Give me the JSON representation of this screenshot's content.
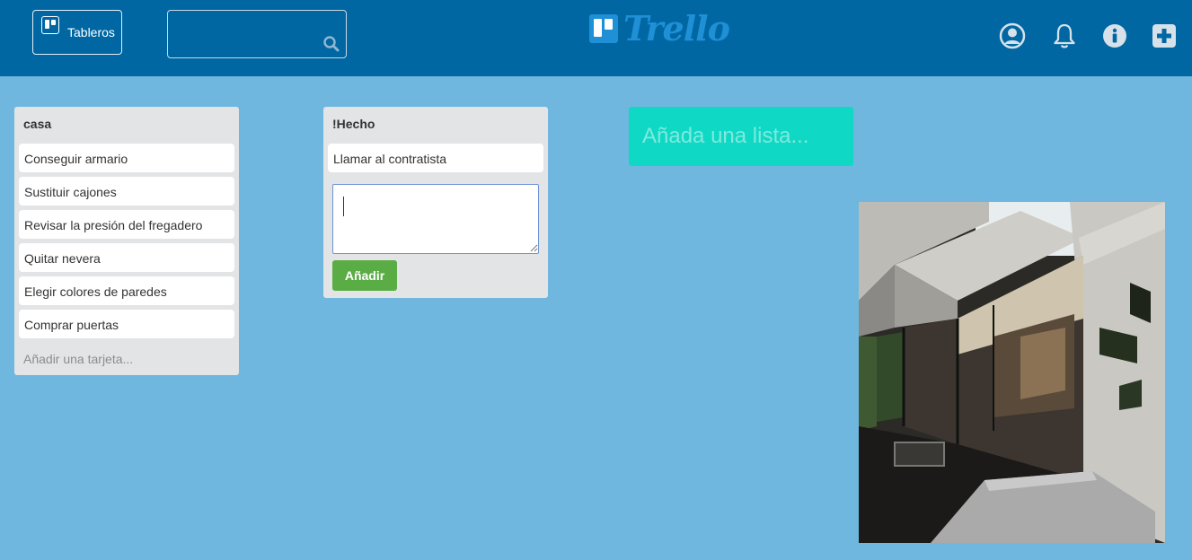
{
  "header": {
    "boards_label": "Tableros",
    "search_value": "",
    "logo_text": "Trello"
  },
  "lists": [
    {
      "title": "casa",
      "cards": [
        "Conseguir armario",
        "Sustituir cajones",
        "Revisar la presión del fregadero",
        "Quitar nevera",
        "Elegir colores de paredes",
        "Comprar puertas"
      ],
      "add_card_label": "Añadir una tarjeta..."
    },
    {
      "title": "!Hecho",
      "cards": [
        "Llamar al contratista"
      ],
      "composer_value": "",
      "add_button_label": "Añadir"
    }
  ],
  "add_list_label": "Añada una lista...",
  "icons": {
    "boards": "board-icon",
    "search": "search-icon",
    "account": "user-circle-icon",
    "notifications": "bell-icon",
    "info": "info-icon",
    "add": "plus-square-icon"
  },
  "colors": {
    "header": "#0067a3",
    "background": "#6fb7df",
    "list": "#e2e4e6",
    "add_button": "#5aac44",
    "add_list": "#0fd9c4"
  }
}
